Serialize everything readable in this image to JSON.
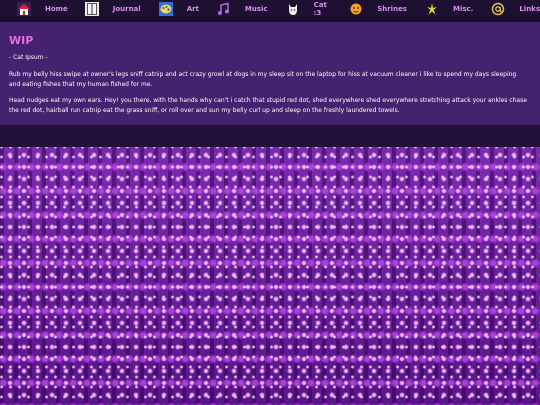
{
  "nav": {
    "items": [
      {
        "label": "Home",
        "icon": "house-icon"
      },
      {
        "label": "Journal",
        "icon": "book-icon"
      },
      {
        "label": "Art",
        "icon": "palette-icon"
      },
      {
        "label": "Music",
        "icon": "music-note-icon"
      },
      {
        "label": "Cat :3",
        "icon": "cat-icon"
      },
      {
        "label": "Shrines",
        "icon": "star-icon"
      },
      {
        "label": "Misc.",
        "icon": "sparkle-icon"
      },
      {
        "label": "Links",
        "icon": "at-sign-icon"
      }
    ]
  },
  "main": {
    "title": "WIP",
    "subtitle": "- Cat Ipsum -",
    "paragraphs": [
      "Rub my belly hiss swipe at owner's legs sniff catnip and act crazy growl at dogs in my sleep sit on the laptop for hiss at vacuum cleaner i like to spend my days sleeping and eating fishes that my human fished for me.",
      "Head nudges eat my own ears. Hey! you there, with the hands why can't i catch that stupid red dot, shed everywhere shed everywhere stretching attack your ankles chase the red dot, hairball run catnip eat the grass sniff, or roll over and sun my belly curl up and sleep on the freshly laundered towels."
    ]
  },
  "colors": {
    "accent": "#e66fe0",
    "nav_text": "#d98ff0",
    "panel": "#452270",
    "navbar": "#1d1030",
    "glitter": "#6a1c9c"
  }
}
